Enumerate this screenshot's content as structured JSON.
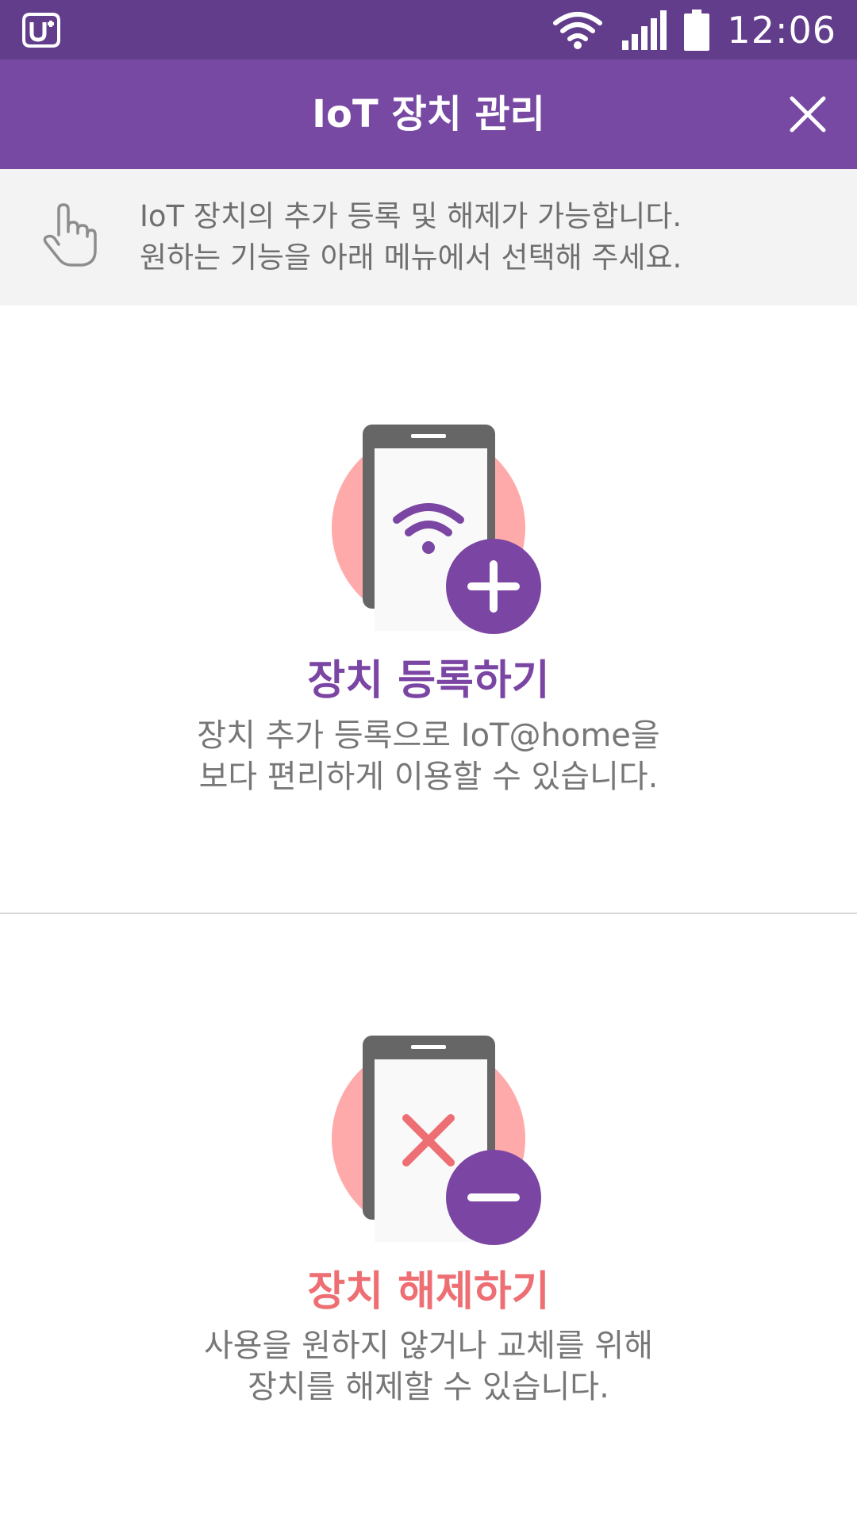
{
  "status_bar": {
    "time": "12:06",
    "icons": [
      "uplus-logo-icon",
      "wifi-icon",
      "signal-icon",
      "battery-icon"
    ]
  },
  "app_bar": {
    "title": "IoT 장치 관리",
    "close_icon": "close-icon"
  },
  "info": {
    "icon": "hand-pointer-icon",
    "line1": "IoT 장치의 추가 등록 및 해제가 가능합니다.",
    "line2": "원하는 기능을 아래 메뉴에서 선택해 주세요."
  },
  "register": {
    "title": "장치 등록하기",
    "desc_line1": "장치 추가 등록으로 IoT@home을",
    "desc_line2": "보다 편리하게 이용할 수 있습니다.",
    "title_color": "#7b45a3"
  },
  "release": {
    "title": "장치 해제하기",
    "desc_line1": "사용을 원하지 않거나 교체를 위해",
    "desc_line2": "장치를 해제할 수 있습니다.",
    "title_color": "#ee6f73"
  },
  "colors": {
    "status_bar": "#623d8c",
    "app_bar": "#7849a3",
    "banner_bg": "#f3f3f3",
    "accent_purple": "#7b45a3",
    "accent_pink": "#ffaaaa",
    "accent_red": "#ee6f73"
  }
}
